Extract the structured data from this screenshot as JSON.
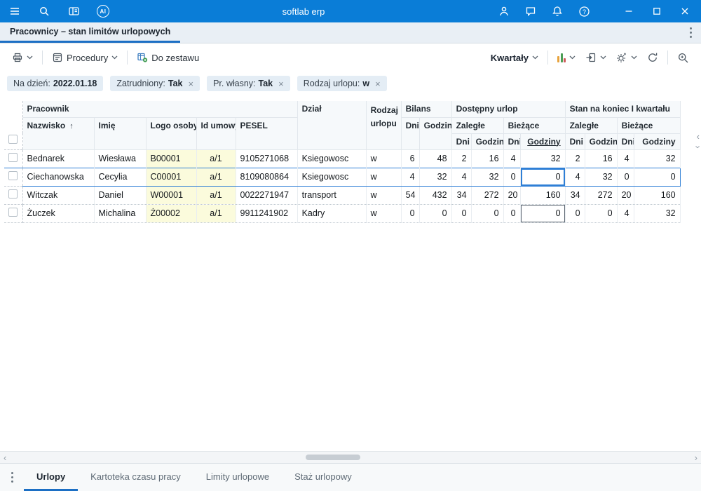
{
  "colors": {
    "titlebar": "#0a7dd7",
    "accent": "#1c6fc4",
    "selection": "#2f7fd6",
    "yellow": "#fbfbdc",
    "chip_bg": "#e4edf5"
  },
  "titlebar": {
    "title": "softlab erp",
    "ai_badge": "AI"
  },
  "tabstrip": {
    "active_tab": "Pracownicy – stan limitów urlopowych"
  },
  "toolbar": {
    "procedury": "Procedury",
    "do_zestawu": "Do zestawu",
    "kwartaly": "Kwartały"
  },
  "filters": [
    {
      "label": "Na dzień:",
      "value": "2022.01.18",
      "closable": false
    },
    {
      "label": "Zatrudniony:",
      "value": "Tak",
      "closable": true
    },
    {
      "label": "Pr. własny:",
      "value": "Tak",
      "closable": true
    },
    {
      "label": "Rodzaj urlopu:",
      "value": "w",
      "closable": true
    }
  ],
  "grid": {
    "header": {
      "pracownik": "Pracownik",
      "nazwisko": "Nazwisko",
      "sort_icon": "↑",
      "imie": "Imię",
      "logo_osoby": "Logo osoby",
      "id_umowy": "Id umowy",
      "pesel": "PESEL",
      "dzial": "Dział",
      "rodzaj_urlopu": "Rodzaj urlopu",
      "bilans": "Bilans",
      "dostepny_urlop": "Dostępny urlop",
      "stan_koniec": "Stan na koniec I kwartału",
      "zalegle": "Zaległe",
      "biezace": "Bieżące",
      "dni": "Dni",
      "godziny": "Godziny"
    },
    "rows": [
      {
        "cells": [
          "Bednarek",
          "Wiesława",
          "B00001",
          "a/1",
          "9105271068",
          "Ksiegowosc",
          "w",
          "6",
          "48",
          "2",
          "16",
          "4",
          "32",
          "2",
          "16",
          "4",
          "32"
        ],
        "selected": false,
        "focus_col": null
      },
      {
        "cells": [
          "Ciechanowska",
          "Cecylia",
          "C00001",
          "a/1",
          "8109080864",
          "Ksiegowosc",
          "w",
          "4",
          "32",
          "4",
          "32",
          "0",
          "0",
          "4",
          "32",
          "0",
          "0"
        ],
        "selected": true,
        "focus_col": 12
      },
      {
        "cells": [
          "Witczak",
          "Daniel",
          "W00001",
          "a/1",
          "0022271947",
          "transport",
          "w",
          "54",
          "432",
          "34",
          "272",
          "20",
          "160",
          "34",
          "272",
          "20",
          "160"
        ],
        "selected": false,
        "focus_col": null
      },
      {
        "cells": [
          "Żuczek",
          "Michalina",
          "Ż00002",
          "a/1",
          "9911241902",
          "Kadry",
          "w",
          "0",
          "0",
          "0",
          "0",
          "0",
          "0",
          "0",
          "0",
          "4",
          "32"
        ],
        "selected": false,
        "focus_col": 12
      }
    ]
  },
  "bottom_tabs": [
    {
      "label": "Urlopy",
      "active": true
    },
    {
      "label": "Kartoteka czasu pracy",
      "active": false
    },
    {
      "label": "Limity urlopowe",
      "active": false
    },
    {
      "label": "Staż urlopowy",
      "active": false
    }
  ]
}
